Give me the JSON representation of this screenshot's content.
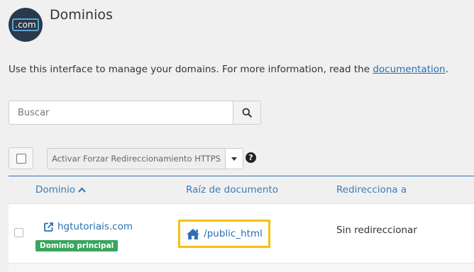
{
  "header": {
    "icon_text": ".com",
    "title": "Dominios"
  },
  "description": {
    "text": "Use this interface to manage your domains. For more information, read the ",
    "link": "documentation",
    "suffix": "."
  },
  "search": {
    "placeholder": "Buscar",
    "value": ""
  },
  "toolbar": {
    "action_label": "Activar Forzar Redireccionamiento HTTPS",
    "help_symbol": "?"
  },
  "table": {
    "columns": [
      "Dominio",
      "Raíz de documento",
      "Redirecciona a"
    ],
    "rows": [
      {
        "domain": "hgtutoriais.com",
        "badge": "Dominio principal",
        "document_root": "/public_html",
        "redirect": "Sin redireccionar"
      }
    ]
  },
  "colors": {
    "accent": "#2a6eb4",
    "highlight": "#f2c10d",
    "badge": "#3aa55d",
    "icon_bg": "#293a4a"
  }
}
